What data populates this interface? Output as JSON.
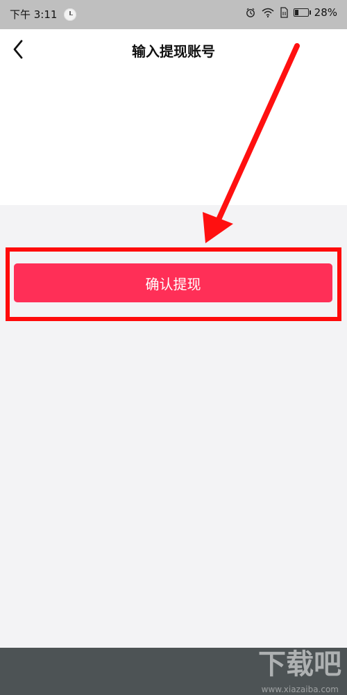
{
  "status_bar": {
    "time": "下午 3:11",
    "battery_percent": "28%",
    "battery_level": 0.28
  },
  "header": {
    "title": "输入提现账号"
  },
  "content": {
    "confirm_button_label": "确认提现"
  },
  "colors": {
    "primary_button": "#ff2f57",
    "annotation_red": "#ff0b0b",
    "bottom_bar": "#4d5355"
  },
  "watermark": {
    "text": "下载吧",
    "url": "www.xiazaiba.com"
  }
}
